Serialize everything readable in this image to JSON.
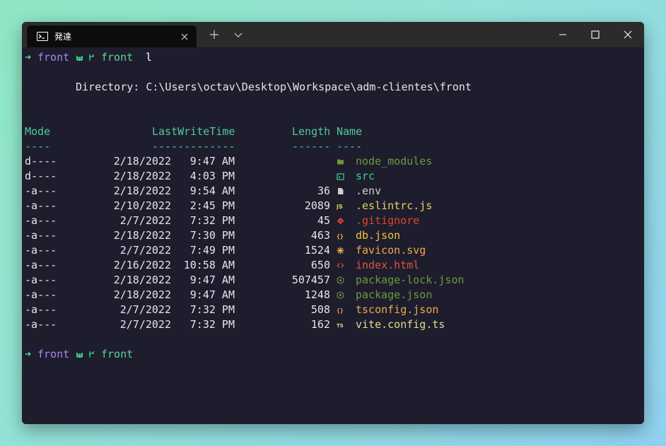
{
  "window": {
    "tab_title": "発達"
  },
  "prompts": [
    {
      "dir": "front",
      "branch": "front",
      "command": "l"
    },
    {
      "dir": "front",
      "branch": "front",
      "command": ""
    }
  ],
  "directory_line": "Directory: C:\\Users\\octav\\Desktop\\Workspace\\adm-clientes\\front",
  "listing": {
    "headers": {
      "mode": "Mode",
      "lastwrite": "LastWriteTime",
      "length": "Length",
      "name": "Name"
    },
    "underlines": {
      "mode": "----",
      "lastwrite": "-------------",
      "length": "------",
      "name": "----"
    },
    "rows": [
      {
        "mode": "d----",
        "date": "2/18/2022",
        "time": "9:47 AM",
        "length": "",
        "name": "node_modules",
        "color": "#6e9a36",
        "icon": "folder-icon",
        "icon_color": "#6e9a36"
      },
      {
        "mode": "d----",
        "date": "2/18/2022",
        "time": "4:03 PM",
        "length": "",
        "name": "src",
        "color": "#3fd18a",
        "icon": "source-folder-icon",
        "icon_color": "#3fd18a"
      },
      {
        "mode": "-a---",
        "date": "2/18/2022",
        "time": "9:54 AM",
        "length": "36",
        "name": ".env",
        "color": "#d0d0d0",
        "icon": "file-icon",
        "icon_color": "#cfcfcf"
      },
      {
        "mode": "-a---",
        "date": "2/10/2022",
        "time": "2:45 PM",
        "length": "2089",
        "name": ".eslintrc.js",
        "color": "#e5d15a",
        "icon": "javascript-icon",
        "icon_color": "#e5d15a"
      },
      {
        "mode": "-a---",
        "date": "2/7/2022",
        "time": "7:32 PM",
        "length": "45",
        "name": ".gitignore",
        "color": "#e0452a",
        "icon": "git-icon",
        "icon_color": "#e0452a"
      },
      {
        "mode": "-a---",
        "date": "2/18/2022",
        "time": "7:30 PM",
        "length": "463",
        "name": "db.json",
        "color": "#f0c43a",
        "icon": "json-icon",
        "icon_color": "#f0c43a"
      },
      {
        "mode": "-a---",
        "date": "2/7/2022",
        "time": "7:49 PM",
        "length": "1524",
        "name": "favicon.svg",
        "color": "#f0a94a",
        "icon": "svg-icon",
        "icon_color": "#f0a94a"
      },
      {
        "mode": "-a---",
        "date": "2/16/2022",
        "time": "10:58 AM",
        "length": "650",
        "name": "index.html",
        "color": "#e0533a",
        "icon": "html-icon",
        "icon_color": "#e0533a"
      },
      {
        "mode": "-a---",
        "date": "2/18/2022",
        "time": "9:47 AM",
        "length": "507457",
        "name": "package-lock.json",
        "color": "#6e9a36",
        "icon": "npm-icon",
        "icon_color": "#6e9a36"
      },
      {
        "mode": "-a---",
        "date": "2/18/2022",
        "time": "9:47 AM",
        "length": "1248",
        "name": "package.json",
        "color": "#6e9a36",
        "icon": "npm-icon",
        "icon_color": "#6e9a36"
      },
      {
        "mode": "-a---",
        "date": "2/7/2022",
        "time": "7:32 PM",
        "length": "508",
        "name": "tsconfig.json",
        "color": "#f0a94a",
        "icon": "json-icon",
        "icon_color": "#f0a94a"
      },
      {
        "mode": "-a---",
        "date": "2/7/2022",
        "time": "7:32 PM",
        "length": "162",
        "name": "vite.config.ts",
        "color": "#e8d88a",
        "icon": "typescript-icon",
        "icon_color": "#e8d88a"
      }
    ]
  }
}
